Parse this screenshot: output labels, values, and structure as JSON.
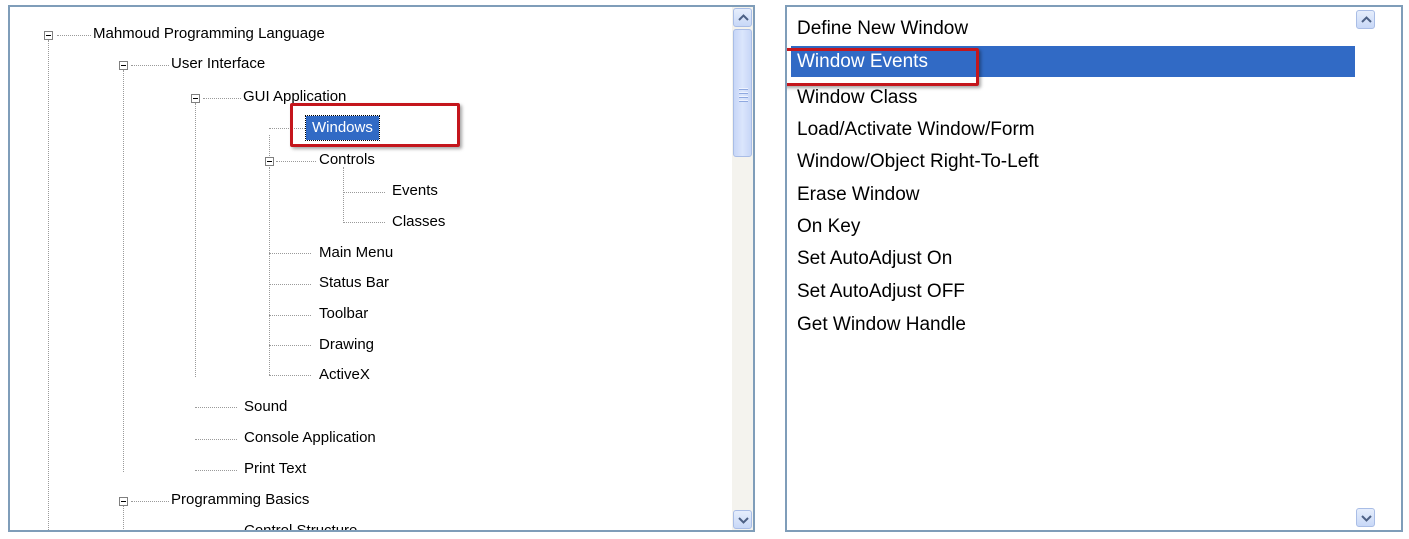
{
  "tree": {
    "items": [
      {
        "label": "Mahmoud Programming Language"
      },
      {
        "label": "User Interface"
      },
      {
        "label": "GUI Application"
      },
      {
        "label": "Windows"
      },
      {
        "label": "Controls"
      },
      {
        "label": "Events"
      },
      {
        "label": "Classes"
      },
      {
        "label": "Main Menu"
      },
      {
        "label": "Status Bar"
      },
      {
        "label": "Toolbar"
      },
      {
        "label": "Drawing"
      },
      {
        "label": "ActiveX"
      },
      {
        "label": "Sound"
      },
      {
        "label": "Console Application"
      },
      {
        "label": "Print Text"
      },
      {
        "label": "Programming Basics"
      },
      {
        "label": "Control Structure"
      }
    ],
    "selected": "Windows"
  },
  "list": {
    "items": [
      {
        "label": "Define New Window"
      },
      {
        "label": "Window Events"
      },
      {
        "label": "Window Class"
      },
      {
        "label": "Load/Activate Window/Form"
      },
      {
        "label": "Window/Object Right-To-Left"
      },
      {
        "label": "Erase Window"
      },
      {
        "label": "On Key"
      },
      {
        "label": "Set AutoAdjust On"
      },
      {
        "label": "Set AutoAdjust OFF"
      },
      {
        "label": "Get Window Handle"
      }
    ],
    "selected": "Window Events"
  },
  "colors": {
    "selection": "#316ac5",
    "highlight_box": "#c4161c",
    "panel_border": "#7f9db9"
  },
  "icons": {
    "expander": "minus-box-icon",
    "scroll_up": "arrow-up-icon",
    "scroll_down": "arrow-down-icon"
  }
}
